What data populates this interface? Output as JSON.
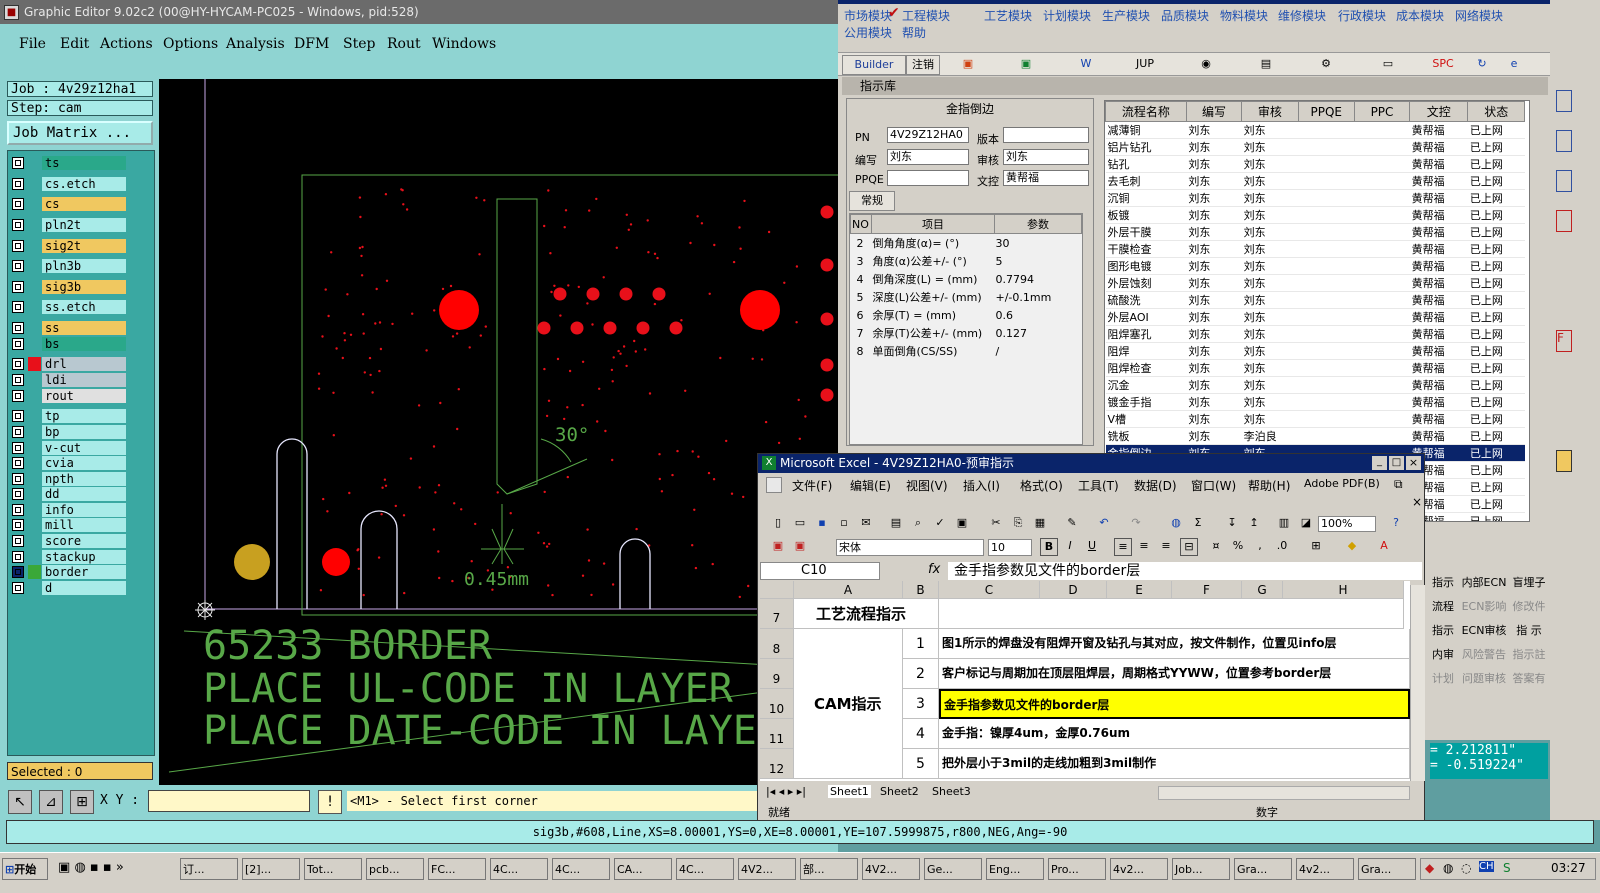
{
  "editor": {
    "title": "Graphic Editor 9.02c2 (00@HY-HYCAM-PC025 - Windows, pid:528)",
    "menu": [
      "File",
      "Edit",
      "Actions",
      "Options",
      "Analysis",
      "DFM",
      "Step",
      "Rout",
      "Windows"
    ],
    "job": "Job : 4v29z12ha1",
    "step": "Step: cam",
    "job_matrix": "Job Matrix ...",
    "layers": [
      {
        "name": "ts",
        "color": "#2aa88a"
      },
      {
        "name": "cs.etch",
        "color": "#a8ebe8"
      },
      {
        "name": "cs",
        "color": "#f0c860"
      },
      {
        "name": "pln2t",
        "color": "#a8ebe8"
      },
      {
        "name": "sig2t",
        "color": "#f0c860"
      },
      {
        "name": "pln3b",
        "color": "#a8ebe8"
      },
      {
        "name": "sig3b",
        "color": "#f0c860"
      },
      {
        "name": "ss.etch",
        "color": "#a8ebe8"
      },
      {
        "name": "ss",
        "color": "#f0c860"
      },
      {
        "name": "bs",
        "color": "#2aa88a"
      },
      {
        "name": "drl",
        "color": "#b8c8d0",
        "swatch": "#e8101a"
      },
      {
        "name": "ldi",
        "color": "#b8c8d0"
      },
      {
        "name": "rout",
        "color": "#e0e0e0"
      },
      {
        "name": "tp",
        "color": "#a8ebe8"
      },
      {
        "name": "bp",
        "color": "#a8ebe8"
      },
      {
        "name": "v-cut",
        "color": "#a8ebe8"
      },
      {
        "name": "cvia",
        "color": "#a8ebe8"
      },
      {
        "name": "npth",
        "color": "#a8ebe8"
      },
      {
        "name": "dd",
        "color": "#a8ebe8"
      },
      {
        "name": "info",
        "color": "#a8ebe8"
      },
      {
        "name": "mill",
        "color": "#a8ebe8"
      },
      {
        "name": "score",
        "color": "#a8ebe8"
      },
      {
        "name": "stackup",
        "color": "#a8ebe8"
      },
      {
        "name": "border",
        "color": "#a8ebe8",
        "swatch": "#3aa838",
        "active": true
      },
      {
        "name": "d",
        "color": "#a8ebe8"
      }
    ],
    "selected": "Selected : 0",
    "xy_label": "X Y :",
    "prompt": "<M1> - Select first corner",
    "status": "sig3b,#608,Line,XS=8.00001,YS=0,XE=8.00001,YE=107.5999875,r800,NEG,Ang=-90",
    "canvas": {
      "angle_label": "30°",
      "dim_label": "0.45mm",
      "text_lines": [
        "65233  BORDER",
        "PLACE UL-CODE IN LAYER",
        "PLACE DATE-CODE IN LAYE"
      ]
    }
  },
  "erp": {
    "menu_row1": [
      "市场模块",
      "工程模块",
      "工艺模块",
      "计划模块",
      "生产模块",
      "品质模块",
      "物料模块",
      "维修模块",
      "行政模块",
      "成本模块",
      "网络模块"
    ],
    "menu_row2": [
      "公用模块",
      "帮助"
    ],
    "toolbar": [
      "Builder",
      "注销",
      "JUP",
      "SPC"
    ],
    "panel_title": "指示库",
    "form": {
      "header": "金指倒边",
      "labels": {
        "pn": "PN",
        "version": "版本",
        "author": "编写",
        "review": "审核",
        "ppqe": "PPQE",
        "wenkong": "文控"
      },
      "values": {
        "pn": "4V29Z12HA0",
        "author": "刘东",
        "review": "刘东",
        "wenkong": "黄帮福"
      },
      "tab": "常规",
      "param_headers": [
        "NO",
        "项目",
        "参数"
      ],
      "params": [
        {
          "no": "2",
          "item": "倒角角度(α)=  (°)",
          "val": "30"
        },
        {
          "no": "3",
          "item": "角度(α)公差+/-  (°)",
          "val": "5"
        },
        {
          "no": "4",
          "item": "倒角深度(L) =  (mm)",
          "val": "0.7794"
        },
        {
          "no": "5",
          "item": "深度(L)公差+/-  (mm)",
          "val": "+/-0.1mm"
        },
        {
          "no": "6",
          "item": "余厚(T) =  (mm)",
          "val": "0.6"
        },
        {
          "no": "7",
          "item": "余厚(T)公差+/-  (mm)",
          "val": "0.127"
        },
        {
          "no": "8",
          "item": "单面倒角(CS/SS)",
          "val": "/"
        }
      ]
    },
    "flow_headers": [
      "流程名称",
      "编写",
      "审核",
      "PPQE",
      "PPC",
      "文控",
      "状态"
    ],
    "flow_rows": [
      [
        "减薄铜",
        "刘东",
        "刘东",
        "",
        "",
        "黄帮福",
        "已上网"
      ],
      [
        "铝片钻孔",
        "刘东",
        "刘东",
        "",
        "",
        "黄帮福",
        "已上网"
      ],
      [
        "钻孔",
        "刘东",
        "刘东",
        "",
        "",
        "黄帮福",
        "已上网"
      ],
      [
        "去毛刺",
        "刘东",
        "刘东",
        "",
        "",
        "黄帮福",
        "已上网"
      ],
      [
        "沉铜",
        "刘东",
        "刘东",
        "",
        "",
        "黄帮福",
        "已上网"
      ],
      [
        "板镀",
        "刘东",
        "刘东",
        "",
        "",
        "黄帮福",
        "已上网"
      ],
      [
        "外层干膜",
        "刘东",
        "刘东",
        "",
        "",
        "黄帮福",
        "已上网"
      ],
      [
        "干膜检查",
        "刘东",
        "刘东",
        "",
        "",
        "黄帮福",
        "已上网"
      ],
      [
        "图形电镀",
        "刘东",
        "刘东",
        "",
        "",
        "黄帮福",
        "已上网"
      ],
      [
        "外层蚀刻",
        "刘东",
        "刘东",
        "",
        "",
        "黄帮福",
        "已上网"
      ],
      [
        "硫酸洗",
        "刘东",
        "刘东",
        "",
        "",
        "黄帮福",
        "已上网"
      ],
      [
        "外层AOI",
        "刘东",
        "刘东",
        "",
        "",
        "黄帮福",
        "已上网"
      ],
      [
        "阻焊塞孔",
        "刘东",
        "刘东",
        "",
        "",
        "黄帮福",
        "已上网"
      ],
      [
        "阻焊",
        "刘东",
        "刘东",
        "",
        "",
        "黄帮福",
        "已上网"
      ],
      [
        "阻焊检查",
        "刘东",
        "刘东",
        "",
        "",
        "黄帮福",
        "已上网"
      ],
      [
        "沉金",
        "刘东",
        "刘东",
        "",
        "",
        "黄帮福",
        "已上网"
      ],
      [
        "镀金手指",
        "刘东",
        "刘东",
        "",
        "",
        "黄帮福",
        "已上网"
      ],
      [
        "V槽",
        "刘东",
        "刘东",
        "",
        "",
        "黄帮福",
        "已上网"
      ],
      [
        "铣板",
        "刘东",
        "李泊良",
        "",
        "",
        "黄帮福",
        "已上网"
      ],
      [
        "金指倒边",
        "刘东",
        "刘东",
        "",
        "",
        "黄帮福",
        "已上网"
      ],
      [
        "",
        "",
        "",
        "",
        "",
        "黄帮福",
        "已上网"
      ],
      [
        "",
        "",
        "",
        "",
        "",
        "黄帮福",
        "已上网"
      ],
      [
        "",
        "",
        "",
        "",
        "",
        "黄帮福",
        "已上网"
      ],
      [
        "",
        "",
        "",
        "",
        "",
        "黄帮福",
        "已上网"
      ]
    ],
    "side_buttons": [
      [
        "指示",
        "内部ECN",
        "盲埋子"
      ],
      [
        "流程",
        "ECN影响",
        "修改件"
      ],
      [
        "指示",
        "ECN审核",
        "指 示"
      ],
      [
        "内审",
        "风险警告",
        "指示註"
      ],
      [
        "计划",
        "问题审核",
        "答案有"
      ]
    ],
    "coords": [
      "= 2.212811\"",
      "= -0.519224\""
    ]
  },
  "excel": {
    "title": "Microsoft Excel - 4V29Z12HA0-预审指示",
    "menu": [
      "文件(F)",
      "编辑(E)",
      "视图(V)",
      "插入(I)",
      "格式(O)",
      "工具(T)",
      "数据(D)",
      "窗口(W)",
      "帮助(H)",
      "Adobe PDF(B)"
    ],
    "font_name": "宋体",
    "font_size": "10",
    "zoom": "100%",
    "cell_ref": "C10",
    "fx": "fx",
    "formula": "金手指参数见文件的border层",
    "columns": [
      "A",
      "B",
      "C",
      "D",
      "E",
      "F",
      "G",
      "H"
    ],
    "section_title": "工艺流程指示",
    "cam_label": "CAM指示",
    "rows": [
      {
        "row": "8",
        "no": "1",
        "text": "图1所示的焊盘没有阻焊开窗及钻孔与其对应，按文件制作，位置见info层"
      },
      {
        "row": "9",
        "no": "2",
        "text": "客户标记与周期加在顶层阻焊层，周期格式YYWW，位置参考border层"
      },
      {
        "row": "10",
        "no": "3",
        "text": "金手指参数见文件的border层",
        "highlight": true
      },
      {
        "row": "11",
        "no": "4",
        "text": "金手指：镍厚4um，金厚0.76um"
      },
      {
        "row": "12",
        "no": "5",
        "text": "把外层小于3mil的走线加粗到3mil制作"
      }
    ],
    "row7": "7",
    "sheets": [
      "Sheet1",
      "Sheet2",
      "Sheet3"
    ],
    "status_left": "就绪",
    "status_right": "数字"
  },
  "taskbar": {
    "start": "开始",
    "tasks": [
      "订...",
      "[2]...",
      "Tot...",
      "pcb...",
      "FC...",
      "4C...",
      "4C...",
      "CA...",
      "4C...",
      "4V2...",
      "部...",
      "4V2...",
      "Ge...",
      "Eng...",
      "Pro...",
      "4v2...",
      "Job...",
      "Gra...",
      "4v2...",
      "Gra..."
    ],
    "clock": "03:27"
  }
}
